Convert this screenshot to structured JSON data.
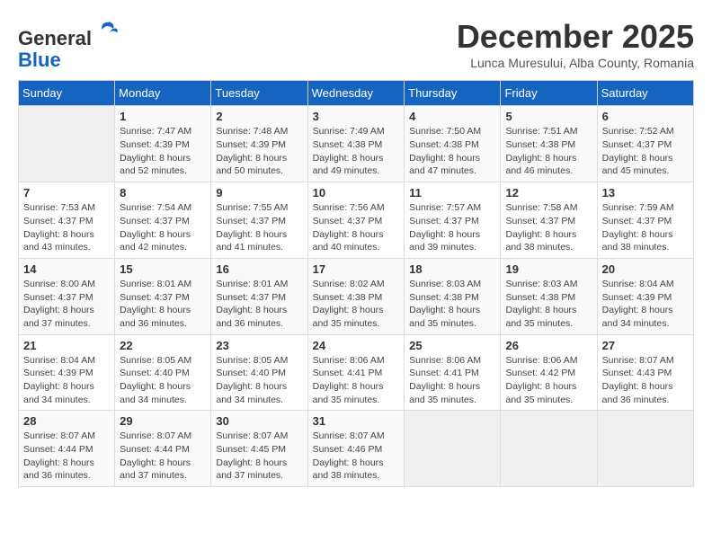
{
  "header": {
    "logo_general": "General",
    "logo_blue": "Blue",
    "month_title": "December 2025",
    "location": "Lunca Muresului, Alba County, Romania"
  },
  "days_of_week": [
    "Sunday",
    "Monday",
    "Tuesday",
    "Wednesday",
    "Thursday",
    "Friday",
    "Saturday"
  ],
  "weeks": [
    [
      {
        "day": "",
        "info": ""
      },
      {
        "day": "1",
        "info": "Sunrise: 7:47 AM\nSunset: 4:39 PM\nDaylight: 8 hours\nand 52 minutes."
      },
      {
        "day": "2",
        "info": "Sunrise: 7:48 AM\nSunset: 4:39 PM\nDaylight: 8 hours\nand 50 minutes."
      },
      {
        "day": "3",
        "info": "Sunrise: 7:49 AM\nSunset: 4:38 PM\nDaylight: 8 hours\nand 49 minutes."
      },
      {
        "day": "4",
        "info": "Sunrise: 7:50 AM\nSunset: 4:38 PM\nDaylight: 8 hours\nand 47 minutes."
      },
      {
        "day": "5",
        "info": "Sunrise: 7:51 AM\nSunset: 4:38 PM\nDaylight: 8 hours\nand 46 minutes."
      },
      {
        "day": "6",
        "info": "Sunrise: 7:52 AM\nSunset: 4:37 PM\nDaylight: 8 hours\nand 45 minutes."
      }
    ],
    [
      {
        "day": "7",
        "info": "Sunrise: 7:53 AM\nSunset: 4:37 PM\nDaylight: 8 hours\nand 43 minutes."
      },
      {
        "day": "8",
        "info": "Sunrise: 7:54 AM\nSunset: 4:37 PM\nDaylight: 8 hours\nand 42 minutes."
      },
      {
        "day": "9",
        "info": "Sunrise: 7:55 AM\nSunset: 4:37 PM\nDaylight: 8 hours\nand 41 minutes."
      },
      {
        "day": "10",
        "info": "Sunrise: 7:56 AM\nSunset: 4:37 PM\nDaylight: 8 hours\nand 40 minutes."
      },
      {
        "day": "11",
        "info": "Sunrise: 7:57 AM\nSunset: 4:37 PM\nDaylight: 8 hours\nand 39 minutes."
      },
      {
        "day": "12",
        "info": "Sunrise: 7:58 AM\nSunset: 4:37 PM\nDaylight: 8 hours\nand 38 minutes."
      },
      {
        "day": "13",
        "info": "Sunrise: 7:59 AM\nSunset: 4:37 PM\nDaylight: 8 hours\nand 38 minutes."
      }
    ],
    [
      {
        "day": "14",
        "info": "Sunrise: 8:00 AM\nSunset: 4:37 PM\nDaylight: 8 hours\nand 37 minutes."
      },
      {
        "day": "15",
        "info": "Sunrise: 8:01 AM\nSunset: 4:37 PM\nDaylight: 8 hours\nand 36 minutes."
      },
      {
        "day": "16",
        "info": "Sunrise: 8:01 AM\nSunset: 4:37 PM\nDaylight: 8 hours\nand 36 minutes."
      },
      {
        "day": "17",
        "info": "Sunrise: 8:02 AM\nSunset: 4:38 PM\nDaylight: 8 hours\nand 35 minutes."
      },
      {
        "day": "18",
        "info": "Sunrise: 8:03 AM\nSunset: 4:38 PM\nDaylight: 8 hours\nand 35 minutes."
      },
      {
        "day": "19",
        "info": "Sunrise: 8:03 AM\nSunset: 4:38 PM\nDaylight: 8 hours\nand 35 minutes."
      },
      {
        "day": "20",
        "info": "Sunrise: 8:04 AM\nSunset: 4:39 PM\nDaylight: 8 hours\nand 34 minutes."
      }
    ],
    [
      {
        "day": "21",
        "info": "Sunrise: 8:04 AM\nSunset: 4:39 PM\nDaylight: 8 hours\nand 34 minutes."
      },
      {
        "day": "22",
        "info": "Sunrise: 8:05 AM\nSunset: 4:40 PM\nDaylight: 8 hours\nand 34 minutes."
      },
      {
        "day": "23",
        "info": "Sunrise: 8:05 AM\nSunset: 4:40 PM\nDaylight: 8 hours\nand 34 minutes."
      },
      {
        "day": "24",
        "info": "Sunrise: 8:06 AM\nSunset: 4:41 PM\nDaylight: 8 hours\nand 35 minutes."
      },
      {
        "day": "25",
        "info": "Sunrise: 8:06 AM\nSunset: 4:41 PM\nDaylight: 8 hours\nand 35 minutes."
      },
      {
        "day": "26",
        "info": "Sunrise: 8:06 AM\nSunset: 4:42 PM\nDaylight: 8 hours\nand 35 minutes."
      },
      {
        "day": "27",
        "info": "Sunrise: 8:07 AM\nSunset: 4:43 PM\nDaylight: 8 hours\nand 36 minutes."
      }
    ],
    [
      {
        "day": "28",
        "info": "Sunrise: 8:07 AM\nSunset: 4:44 PM\nDaylight: 8 hours\nand 36 minutes."
      },
      {
        "day": "29",
        "info": "Sunrise: 8:07 AM\nSunset: 4:44 PM\nDaylight: 8 hours\nand 37 minutes."
      },
      {
        "day": "30",
        "info": "Sunrise: 8:07 AM\nSunset: 4:45 PM\nDaylight: 8 hours\nand 37 minutes."
      },
      {
        "day": "31",
        "info": "Sunrise: 8:07 AM\nSunset: 4:46 PM\nDaylight: 8 hours\nand 38 minutes."
      },
      {
        "day": "",
        "info": ""
      },
      {
        "day": "",
        "info": ""
      },
      {
        "day": "",
        "info": ""
      }
    ]
  ]
}
